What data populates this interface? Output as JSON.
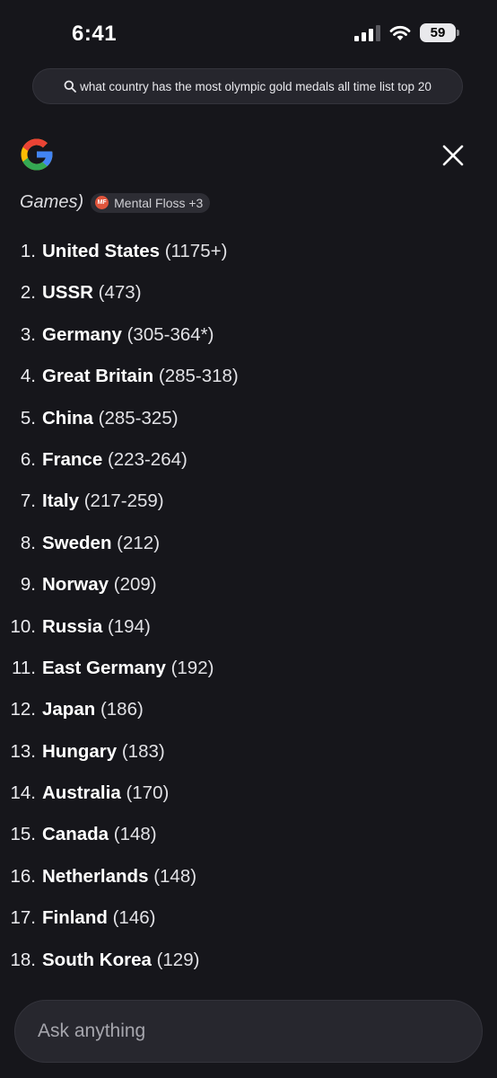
{
  "status_bar": {
    "time": "6:41",
    "battery": "59"
  },
  "query": {
    "text": "what country has the most olympic gold medals all time list top 20"
  },
  "header": {
    "logo": "google-g-logo",
    "close_icon": "close-icon"
  },
  "source_line": {
    "prefix": "Games)",
    "chip_icon_text": "MF",
    "chip_label": "Mental Floss +3"
  },
  "ranking": [
    {
      "num": "1.",
      "country": "United States",
      "medals": "(1175+)"
    },
    {
      "num": "2.",
      "country": "USSR",
      "medals": "(473)"
    },
    {
      "num": "3.",
      "country": "Germany",
      "medals": "(305-364*)"
    },
    {
      "num": "4.",
      "country": "Great Britain",
      "medals": "(285-318)"
    },
    {
      "num": "5.",
      "country": "China",
      "medals": "(285-325)"
    },
    {
      "num": "6.",
      "country": "France",
      "medals": "(223-264)"
    },
    {
      "num": "7.",
      "country": "Italy",
      "medals": "(217-259)"
    },
    {
      "num": "8.",
      "country": "Sweden",
      "medals": "(212)"
    },
    {
      "num": "9.",
      "country": "Norway",
      "medals": "(209)"
    },
    {
      "num": "10.",
      "country": "Russia",
      "medals": "(194)"
    },
    {
      "num": "11.",
      "country": "East Germany",
      "medals": "(192)"
    },
    {
      "num": "12.",
      "country": "Japan",
      "medals": "(186)"
    },
    {
      "num": "13.",
      "country": "Hungary",
      "medals": "(183)"
    },
    {
      "num": "14.",
      "country": "Australia",
      "medals": "(170)"
    },
    {
      "num": "15.",
      "country": "Canada",
      "medals": "(148)"
    },
    {
      "num": "16.",
      "country": "Netherlands",
      "medals": "(148)"
    },
    {
      "num": "17.",
      "country": "Finland",
      "medals": "(146)"
    },
    {
      "num": "18.",
      "country": "South Korea",
      "medals": "(129)"
    }
  ],
  "input": {
    "placeholder": "Ask anything"
  },
  "colors": {
    "background": "#16161b",
    "google_blue": "#4285F4",
    "google_red": "#EA4335",
    "google_yellow": "#FBBC05",
    "google_green": "#34A853",
    "chip_logo": "#e0553c"
  }
}
